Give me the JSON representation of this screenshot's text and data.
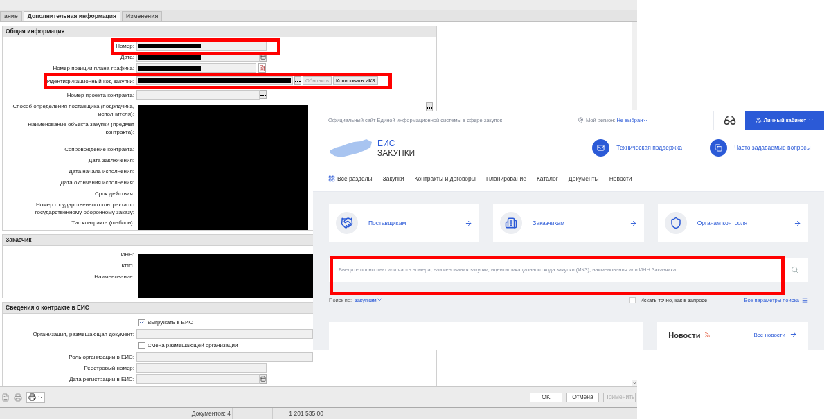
{
  "form": {
    "tabs": [
      {
        "label": "ание",
        "selected": false
      },
      {
        "label": "Дополнительная информация",
        "selected": true
      },
      {
        "label": "Изменения",
        "selected": false
      }
    ],
    "sections": [
      {
        "title": "Общая информация",
        "fields": [
          {
            "label": "Номер:",
            "kind": "text",
            "redacted": true
          },
          {
            "label": "Дата:",
            "kind": "date",
            "redacted": true
          },
          {
            "label": "Номер позиции плана-графика:",
            "kind": "doc",
            "redacted": true
          },
          {
            "label": "Идентификационный код закупки:",
            "kind": "code",
            "redacted": true,
            "buttons": [
              {
                "label": "Обновить",
                "disabled": true
              },
              {
                "label": "Копировать ИКЗ",
                "disabled": false
              }
            ]
          },
          {
            "label": "Номер проекта контракта:",
            "kind": "lookup",
            "redacted": false
          },
          {
            "label": "Способ определения поставщика (подрядчика, исполнителя):",
            "kind": "covered_lookup"
          },
          {
            "label": "Наименование объекта закупки (предмет контракта):",
            "kind": "covered_tall"
          },
          {
            "label": "Сопровождение контракта:",
            "kind": "covered"
          },
          {
            "label": "Дата заключения:",
            "kind": "covered"
          },
          {
            "label": "Дата начала исполнения:",
            "kind": "covered"
          },
          {
            "label": "Дата окончания исполнения:",
            "kind": "covered"
          },
          {
            "label": "Срок действия:",
            "kind": "covered"
          },
          {
            "label": "Номер государственного контракта по государственному оборонному заказу:",
            "kind": "covered_mid"
          },
          {
            "label": "Тип контракта (шаблон):",
            "kind": "covered"
          }
        ]
      },
      {
        "title": "Заказчик",
        "fields": [
          {
            "label": "ИНН:",
            "kind": "covered"
          },
          {
            "label": "КПП:",
            "kind": "covered"
          },
          {
            "label": "Наименование:",
            "kind": "covered_tall"
          }
        ]
      },
      {
        "title": "Сведения о контракте в ЕИС",
        "fields": [
          {
            "label": "Выгружать в ЕИС",
            "kind": "checkbox",
            "checked": true
          },
          {
            "label": "Организация, размещающая документ:",
            "kind": "wide",
            "redacted": false
          },
          {
            "label": "Смена размещающей организации",
            "kind": "checkbox",
            "checked": false
          },
          {
            "label": "Роль организации в ЕИС:",
            "kind": "wide",
            "redacted": false
          },
          {
            "label": "Реестровый номер:",
            "kind": "text",
            "redacted": false
          },
          {
            "label": "Дата регистрации в ЕИС:",
            "kind": "date",
            "redacted": false
          }
        ]
      }
    ],
    "buttons": [
      {
        "label": "OK",
        "disabled": false
      },
      {
        "label": "Отмена",
        "disabled": false
      },
      {
        "label": "Применить",
        "disabled": true
      }
    ],
    "status_bar": [
      "Документов: 4",
      "1 201 535,00"
    ]
  },
  "web": {
    "tagline": "Официальный сайт Единой информационной системы в сфере закупок",
    "region_label": "Мой регион:",
    "region_value": "Не выбран",
    "account": "Личный кабинет",
    "logo_top": "ЕИС",
    "logo_bottom": "ЗАКУПКИ",
    "help_links": [
      {
        "label": "Техническая поддержка",
        "kind": "mail"
      },
      {
        "label": "Часто задаваемые вопросы",
        "kind": "faq"
      }
    ],
    "nav": [
      "Все разделы",
      "Закупки",
      "Контракты и договоры",
      "Планирование",
      "Каталог",
      "Документы",
      "Новости"
    ],
    "audiences": [
      {
        "label": "Поставщикам",
        "kind": "suppliers"
      },
      {
        "label": "Заказчикам",
        "kind": "customers"
      },
      {
        "label": "Органам контроля",
        "kind": "control"
      }
    ],
    "search": {
      "placeholder": "Введите полностью или часть номера, наименования закупки, идентификационного кода закупки (ИКЗ), наименования или ИНН Заказчика"
    },
    "search_by_label": "Поиск по:",
    "search_by_value": "закупкам",
    "exact_search": {
      "label": "Искать точно, как в запросе",
      "checked": false
    },
    "all_params": "Все параметры поиска",
    "news": {
      "title": "Новости",
      "link": "Все новости"
    }
  }
}
